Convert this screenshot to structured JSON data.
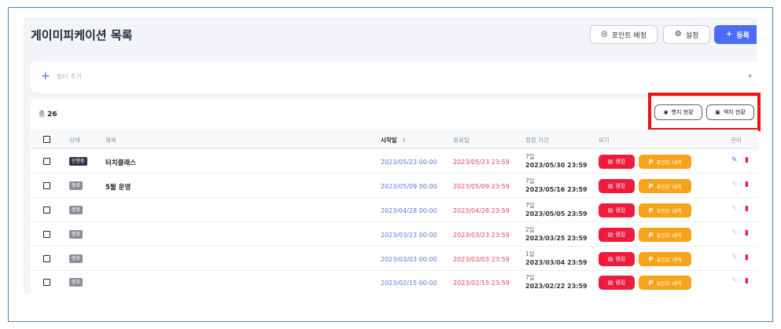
{
  "page": {
    "title": "게이미피케이션 목록"
  },
  "header_buttons": {
    "point_assign": "포인트 배정",
    "settings": "설정",
    "register": "등록"
  },
  "filter": {
    "add_label": "필터 추가"
  },
  "summary": {
    "total_prefix": "총",
    "total_count": "26"
  },
  "status_buttons": {
    "badge_status": "뱃지 현황",
    "frame_status": "액자 현황"
  },
  "table": {
    "headers": {
      "status": "상태",
      "title": "제목",
      "start_date": "시작일",
      "end_date": "종료일",
      "settle_period": "정정 기간",
      "view": "보기",
      "manage": "관리"
    },
    "rows": [
      {
        "status": "진행중",
        "title": "터치클래스",
        "start": "2023/05/23 00:00",
        "end": "2023/05/23 23:59",
        "period_days": "7일",
        "period_end": "2023/05/30 23:59",
        "ranking": "랭킹",
        "point_history": "포인트 내역"
      },
      {
        "status": "종료",
        "title": "5월 운영",
        "start": "2023/05/09 00:00",
        "end": "2023/05/09 23:59",
        "period_days": "7일",
        "period_end": "2023/05/16 23:59",
        "ranking": "랭킹",
        "point_history": "포인트 내역"
      },
      {
        "status": "종료",
        "title": "",
        "start": "2023/04/28 00:00",
        "end": "2023/04/28 23:59",
        "period_days": "7일",
        "period_end": "2023/05/05 23:59",
        "ranking": "랭킹",
        "point_history": "포인트 내역"
      },
      {
        "status": "종료",
        "title": "",
        "start": "2023/03/23 00:00",
        "end": "2023/03/23 23:59",
        "period_days": "2일",
        "period_end": "2023/03/25 23:59",
        "ranking": "랭킹",
        "point_history": "포인트 내역"
      },
      {
        "status": "종료",
        "title": "",
        "start": "2023/03/03 00:00",
        "end": "2023/03/03 23:59",
        "period_days": "1일",
        "period_end": "2023/03/04 23:59",
        "ranking": "랭킹",
        "point_history": "포인트 내역"
      },
      {
        "status": "종료",
        "title": "",
        "start": "2023/02/15 00:00",
        "end": "2023/02/15 23:59",
        "period_days": "7일",
        "period_end": "2023/02/22 23:59",
        "ranking": "랭킹",
        "point_history": "포인트 내역"
      }
    ]
  },
  "colors": {
    "primary": "#4a6cf7",
    "start_date": "#5a78d6",
    "end_date": "#e0465a",
    "ranking_button": "#ee1b3c",
    "point_button": "#f8a319",
    "highlight_border": "#ee1111"
  }
}
